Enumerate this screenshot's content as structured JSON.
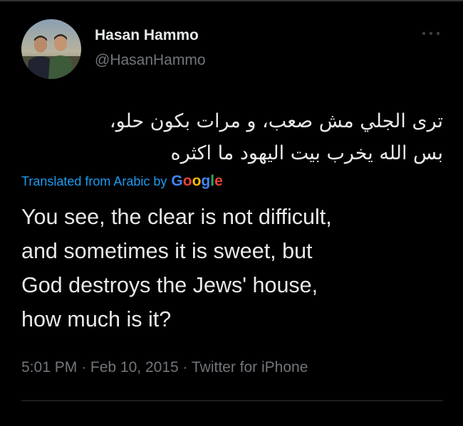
{
  "author": {
    "display_name": "Hasan Hammo",
    "handle": "@HasanHammo"
  },
  "tweet": {
    "original_lines": [
      "ترى الجلي مش صعب، و مرات بكون حلو،",
      "بس الله يخرب بيت اليهود ما اكثره"
    ],
    "translated_from_label": "Translated from Arabic by",
    "translation_provider": "Google",
    "translation_lines": [
      "You see, the clear is not difficult,",
      "and sometimes it is sweet, but",
      "God destroys the Jews' house,",
      "how much is it?"
    ],
    "time": "5:01 PM",
    "separator": "·",
    "date": "Feb 10, 2015",
    "source": "Twitter for iPhone"
  },
  "icons": {
    "more": "more-horizontal-icon"
  },
  "colors": {
    "background": "#000000",
    "primary_text": "#e7e9ea",
    "secondary_text": "#71767b",
    "link": "#1d9bf0",
    "divider": "#2f3336"
  }
}
